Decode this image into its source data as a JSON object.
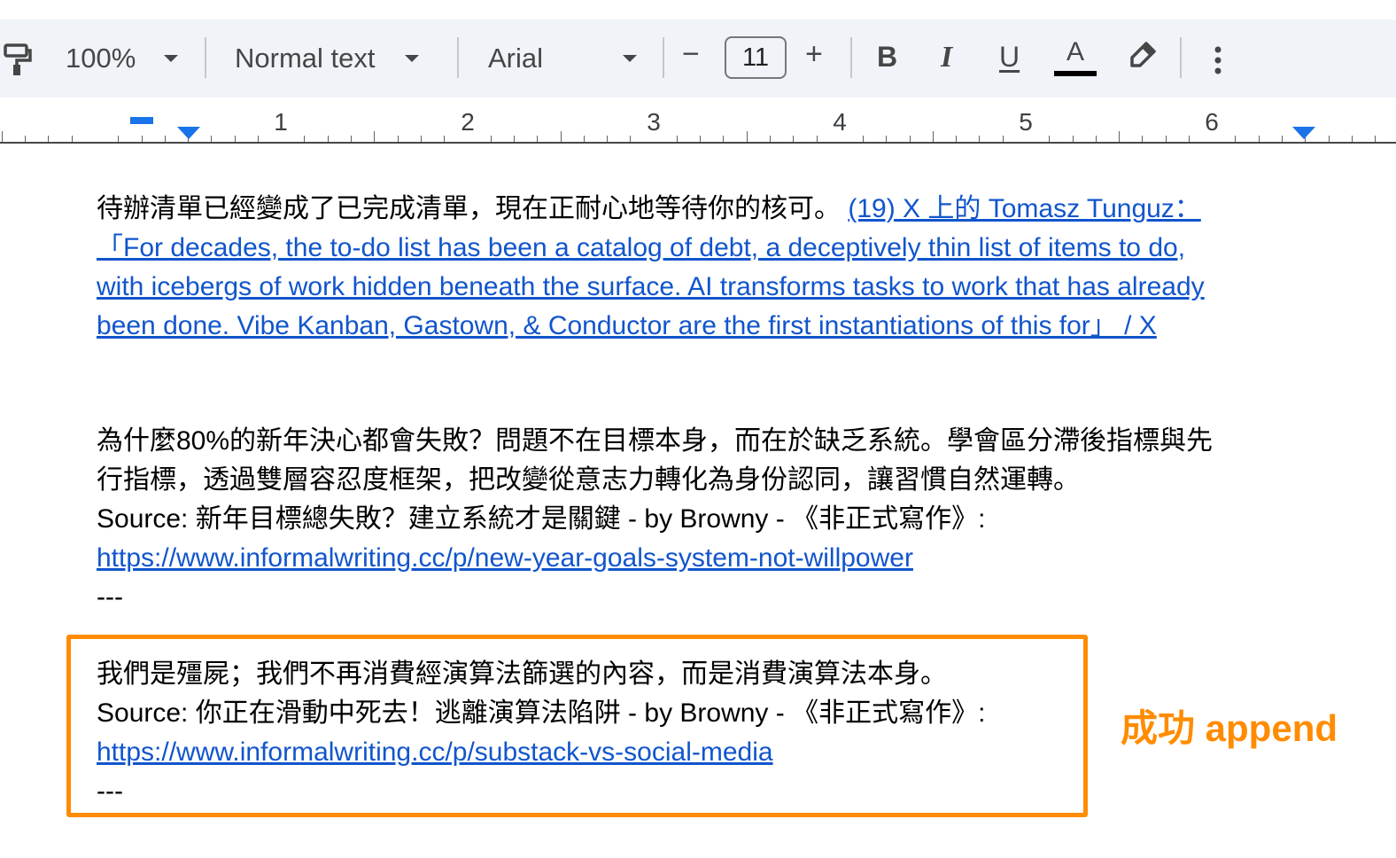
{
  "toolbar": {
    "zoom": "100%",
    "style": "Normal text",
    "font": "Arial",
    "font_size": "11",
    "decrease_label": "−",
    "increase_label": "+",
    "bold_label": "B",
    "italic_label": "I",
    "underline_label": "U",
    "text_color_label": "A",
    "icons": [
      "paint-format-icon",
      "dropdown-caret-icon",
      "highlighter-icon",
      "more-vert-icon"
    ],
    "text_color_bar": "#000000"
  },
  "ruler": {
    "numbers": [
      "1",
      "2",
      "3",
      "4",
      "5",
      "6"
    ]
  },
  "document": {
    "p1_text": "待辦清單已經變成了已完成清單，現在正耐心地等待你的核可。",
    "p1_link_lines": [
      "(19) X 上的 Tomasz Tunguz：",
      "「For decades, the to-do list has been a catalog of debt, a deceptively thin list of items to do,",
      "with icebergs of work hidden beneath the surface. AI transforms tasks to work that has already",
      "been done. Vibe Kanban, Gastown, & Conductor are the first instantiations of this for」 / X"
    ],
    "p2_line1": "為什麼80%的新年決心都會失敗？問題不在目標本身，而在於缺乏系統。學會區分滯後指標與先",
    "p2_line2": "行指標，透過雙層容忍度框架，把改變從意志力轉化為身份認同，讓習慣自然運轉。",
    "p2_source": "Source: 新年目標總失敗？建立系統才是關鍵 - by Browny - 《非正式寫作》:",
    "p2_url": "https://www.informalwriting.cc/p/new-year-goals-system-not-willpower",
    "p2_sep": "---",
    "p3_line1": "我們是殭屍；我們不再消費經演算法篩選的內容，而是消費演算法本身。",
    "p3_source": "Source: 你正在滑動中死去！逃離演算法陷阱 - by Browny - 《非正式寫作》:",
    "p3_url": "https://www.informalwriting.cc/p/substack-vs-social-media",
    "p3_sep": "---"
  },
  "annotation": {
    "label": "成功 append",
    "color": "#ff8c00"
  },
  "colors": {
    "link": "#1155cc",
    "toolbar_bg": "#f0f4f9",
    "highlight": "#ff8c00"
  }
}
